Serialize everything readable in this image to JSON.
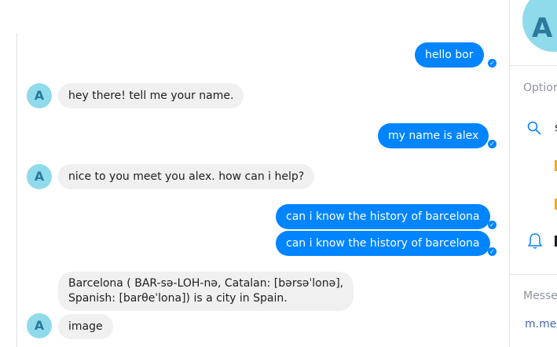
{
  "conversation": {
    "messages": [
      {
        "id": "m1",
        "from": "user",
        "text": "hello bor"
      },
      {
        "id": "m2",
        "from": "bot",
        "text": "hey there! tell me your name."
      },
      {
        "id": "m3",
        "from": "user",
        "text": "my name is alex"
      },
      {
        "id": "m4",
        "from": "bot",
        "text": "nice to you meet you alex. how can i help?"
      },
      {
        "id": "m5",
        "from": "user",
        "text": "can i know the history of barcelona"
      },
      {
        "id": "m6",
        "from": "user",
        "text": "can i know the history of barcelona"
      },
      {
        "id": "m7",
        "from": "bot",
        "lines": [
          "Barcelona ( BAR-sə-LOH-nə, Catalan: [bərsəˈlonə],",
          "Spanish: [barθeˈlona]) is a city in Spain."
        ]
      },
      {
        "id": "m8",
        "from": "bot",
        "text": "image"
      }
    ],
    "bot_avatar_letter": "A",
    "sent_check_glyph": "✓"
  },
  "sidebar": {
    "avatar_letter": "A",
    "options_label": "Optior",
    "search_icon": "search-icon",
    "bell_icon": "bell-icon",
    "search_trunc": "s",
    "messenger_label": "Messe",
    "link_text": "m.me/"
  },
  "colors": {
    "outgoing": "#0084ff",
    "incoming": "#f1f0f0",
    "avatar": "#8fdaeb",
    "accent_orange": "#f5a623"
  }
}
